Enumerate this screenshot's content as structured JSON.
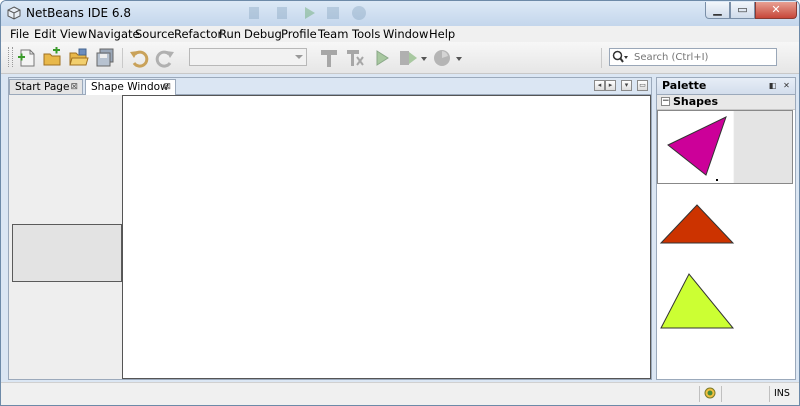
{
  "window": {
    "title": "NetBeans IDE 6.8"
  },
  "menu": [
    "File",
    "Edit",
    "View",
    "Navigate",
    "Source",
    "Refactor",
    "Run",
    "Debug",
    "Profile",
    "Team",
    "Tools",
    "Window",
    "Help"
  ],
  "toolbar": {
    "search_placeholder": "Search (Ctrl+I)"
  },
  "tabs": [
    {
      "label": "Start Page",
      "close": "⊠"
    },
    {
      "label": "Shape Window",
      "close": "⊠"
    }
  ],
  "palette": {
    "title": "Palette",
    "category": "Shapes",
    "category_toggle": "−",
    "items": [
      {
        "name": "triangle-magenta",
        "color": "#cc0099"
      },
      {
        "name": "triangle-red",
        "color": "#cc3300"
      },
      {
        "name": "triangle-lime",
        "color": "#ccff33"
      }
    ]
  },
  "statusbar": {
    "mode": "INS"
  }
}
